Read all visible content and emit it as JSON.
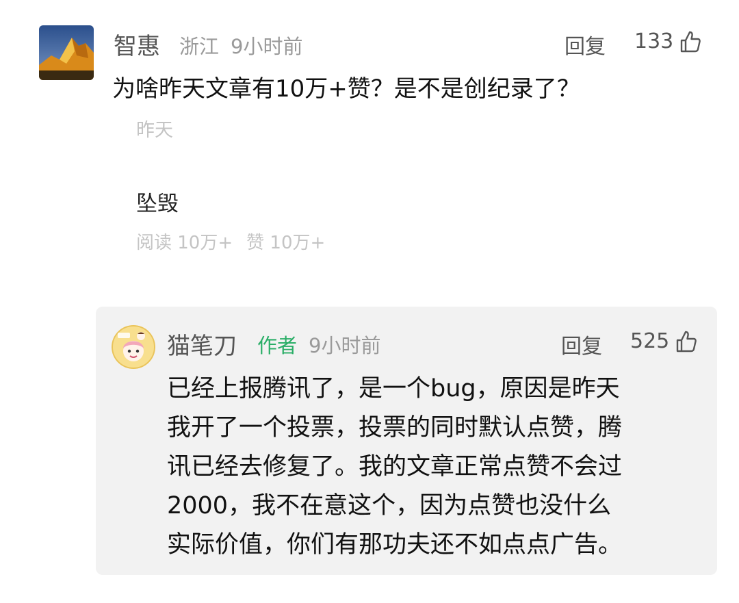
{
  "comment": {
    "username": "智惠",
    "location": "浙江",
    "time": "9小时前",
    "reply_label": "回复",
    "likes": "133",
    "text": "为啥昨天文章有10万+赞？是不是创纪录了？",
    "quoted_image": {
      "date": "昨天",
      "title": "坠毁",
      "reads": "阅读 10万+",
      "likes": "赞 10万+"
    }
  },
  "reply": {
    "username": "猫笔刀",
    "author_tag": "作者",
    "time": "9小时前",
    "reply_label": "回复",
    "likes": "525",
    "lines": [
      "已经上报腾讯了，是一个bug，原因是昨天",
      "我开了一个投票，投票的同时默认点赞，腾",
      "讯已经去修复了。我的文章正常点赞不会过",
      "2000，我不在意这个，因为点赞也没什么",
      "实际价值，你们有那功夫还不如点点广告。"
    ]
  },
  "colors": {
    "author_tag": "#2aae67",
    "reply_bg": "#f2f2f2",
    "meta": "#9a9a9a"
  },
  "icons": {
    "like": "thumbs-up-icon"
  }
}
